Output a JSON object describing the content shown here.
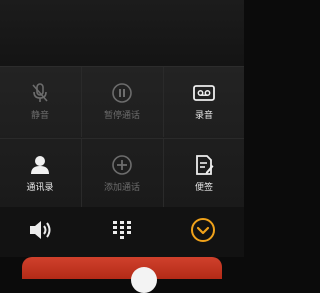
{
  "controls": [
    {
      "label": "静音",
      "icon": "mic-off-icon",
      "enabled": false
    },
    {
      "label": "暂停通话",
      "icon": "pause-icon",
      "enabled": false
    },
    {
      "label": "录音",
      "icon": "cassette-icon",
      "enabled": true
    },
    {
      "label": "通讯录",
      "icon": "contact-icon",
      "enabled": true
    },
    {
      "label": "添加通话",
      "icon": "add-call-icon",
      "enabled": false
    },
    {
      "label": "便签",
      "icon": "note-icon",
      "enabled": true
    }
  ],
  "bottom_bar": {
    "speaker_icon": "speaker-icon",
    "dialpad_icon": "dialpad-icon",
    "collapse_icon": "chevron-down-icon"
  },
  "colors": {
    "accent": "#f0a21a",
    "end_call": "#c8371f",
    "disabled": "#6c6c6c",
    "enabled": "#e9e9e9"
  }
}
